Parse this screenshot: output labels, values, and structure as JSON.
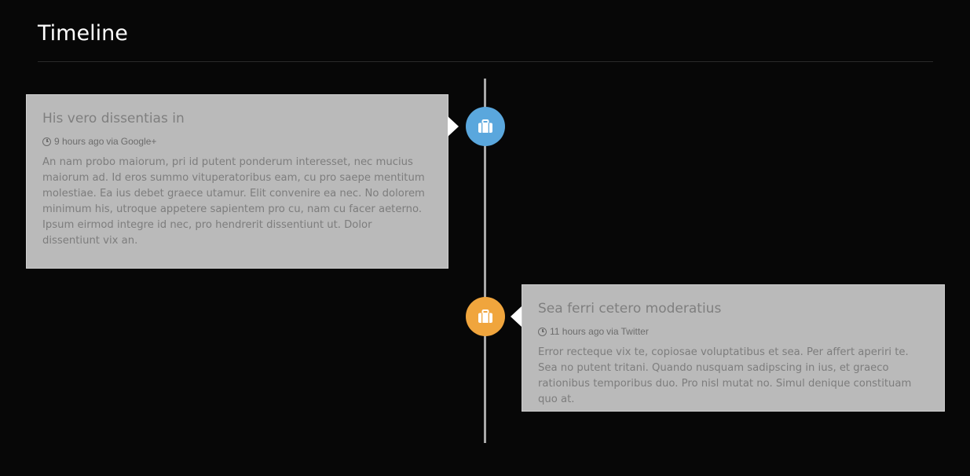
{
  "page": {
    "title": "Timeline"
  },
  "colors": {
    "background": "#070707",
    "card_background": "#bababa",
    "timeline_line": "#a8a8a8",
    "node_blue": "#5aa7dd",
    "node_orange": "#f0a53d"
  },
  "timeline": {
    "entries": [
      {
        "side": "left",
        "heading": "His vero dissentias in",
        "time_ago": "9 hours ago",
        "via_label": "via",
        "source": "Google+",
        "icon": "briefcase-icon",
        "node_color": "#5aa7dd",
        "body": "An nam probo maiorum, pri id putent ponderum interesset, nec mucius maiorum ad. Id eros summo vituperatoribus eam, cu pro saepe mentitum molestiae. Ea ius debet graece utamur. Elit convenire ea nec. No dolorem minimum his, utroque appetere sapientem pro cu, nam cu facer aeterno. Ipsum eirmod integre id nec, pro hendrerit dissentiunt ut. Dolor dissentiunt vix an."
      },
      {
        "side": "right",
        "heading": "Sea ferri cetero moderatius",
        "time_ago": "11 hours ago",
        "via_label": "via",
        "source": "Twitter",
        "icon": "briefcase-icon",
        "node_color": "#f0a53d",
        "body": "Error recteque vix te, copiosae voluptatibus et sea. Per affert aperiri te. Sea no putent tritani. Quando nusquam sadipscing in ius, et graeco rationibus temporibus duo. Pro nisl mutat no. Simul denique constituam quo at."
      }
    ]
  }
}
